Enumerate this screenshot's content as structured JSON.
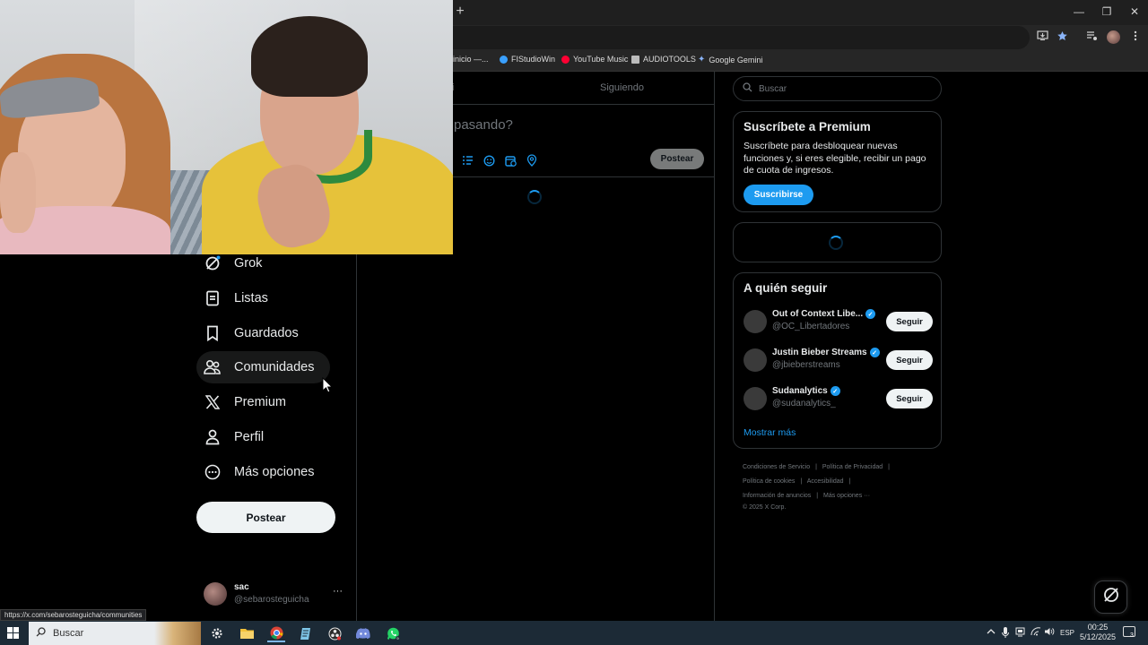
{
  "browser": {
    "new_tab": "+",
    "window_controls": [
      "—",
      "❐",
      "✕"
    ],
    "bookmarks": [
      {
        "label": "inicio —...",
        "color": "#555555"
      },
      {
        "label": "FIStudioWin",
        "color": "#3aa0ff"
      },
      {
        "label": "YouTube Music",
        "color": "#ff0033"
      },
      {
        "label": "AUDIOTOOLS",
        "color": "#bbbbbb"
      },
      {
        "label": "Google Gemini",
        "color": "#8ab4f8"
      }
    ],
    "status_url": "https://x.com/sebarosteguicha/communities"
  },
  "nav": {
    "items": [
      {
        "label": "Grok",
        "icon": "grok-icon"
      },
      {
        "label": "Listas",
        "icon": "lists-icon"
      },
      {
        "label": "Guardados",
        "icon": "bookmark-icon"
      },
      {
        "label": "Comunidades",
        "icon": "communities-icon"
      },
      {
        "label": "Premium",
        "icon": "x-logo-icon"
      },
      {
        "label": "Perfil",
        "icon": "profile-icon"
      },
      {
        "label": "Más opciones",
        "icon": "more-options-icon"
      }
    ],
    "post_button": "Postear",
    "account": {
      "name": "sac",
      "handle": "@sebarosteguicha",
      "more": "···"
    }
  },
  "timeline": {
    "tab_left": "i",
    "tab_right": "Siguiendo",
    "compose_placeholder": "pasando?",
    "compose_post": "Postear"
  },
  "sidebar": {
    "search_placeholder": "Buscar",
    "premium": {
      "title": "Suscríbete a Premium",
      "text": "Suscríbete para desbloquear nuevas funciones y, si eres elegible, recibir un pago de cuota de ingresos.",
      "button": "Suscribirse"
    },
    "who_to_follow": {
      "title": "A quién seguir",
      "accounts": [
        {
          "name": "Out of Context Libe...",
          "handle": "@OC_Libertadores",
          "button": "Seguir"
        },
        {
          "name": "Justin Bieber Streams",
          "handle": "@jbieberstreams",
          "button": "Seguir"
        },
        {
          "name": "Sudanalytics",
          "handle": "@sudanalytics_",
          "button": "Seguir"
        }
      ],
      "show_more": "Mostrar más"
    },
    "footer": {
      "links": [
        "Condiciones de Servicio",
        "|",
        "Política de Privacidad",
        "|",
        "Política de cookies",
        "|",
        "Accesibilidad",
        "|",
        "Información de anuncios",
        "|",
        "Más opciones ···"
      ],
      "copyright": "© 2025 X Corp."
    }
  },
  "taskbar": {
    "search_label": "Buscar",
    "language": "ESP",
    "time": "00:25",
    "date": "5/12/2025",
    "notifications": "3"
  },
  "colors": {
    "accent": "#1d9bf0",
    "background": "#000000",
    "border": "#2f3336",
    "muted_text": "#71767b"
  }
}
